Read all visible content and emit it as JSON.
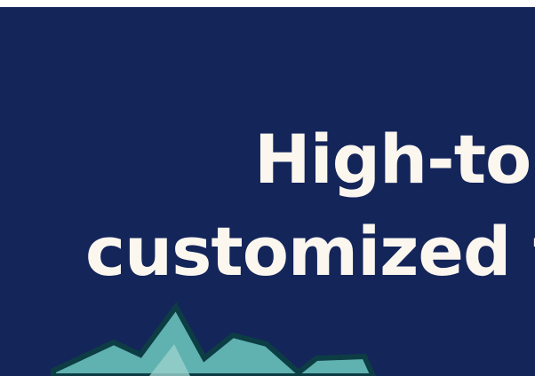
{
  "headline": {
    "line1": "High-tou",
    "line2": "customized t"
  },
  "colors": {
    "background": "#14255a",
    "text": "#fbf7ef",
    "burst_fill": "#5fb2b0",
    "burst_highlight": "#9ad0cc",
    "burst_outline": "#0d3d44"
  },
  "icons": {
    "decoration": "spiky-burst-icon"
  }
}
